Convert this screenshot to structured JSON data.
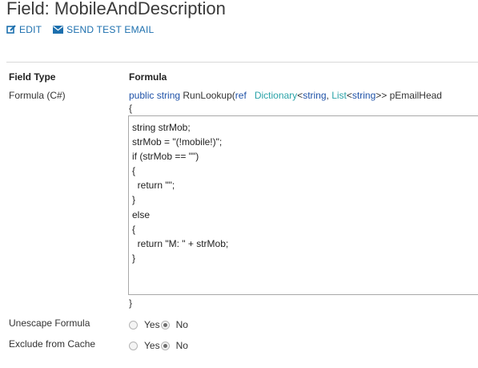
{
  "header": {
    "title": "Field: MobileAndDescription",
    "edit_label": "EDIT",
    "send_test_email_label": "SEND TEST EMAIL"
  },
  "table": {
    "col_field_type": "Field Type",
    "col_formula": "Formula"
  },
  "formula_row": {
    "label": "Formula (C#)",
    "signature": {
      "public_kw": "public",
      "string_kw": "string",
      "method": "RunLookup(",
      "ref_kw": "ref",
      "dictionary_type": "Dictionary",
      "lt1": "<",
      "string_kw2": "string",
      "comma": ", ",
      "list_type": "List",
      "lt2": "<",
      "string_kw3": "string",
      "gt": ">> pEmailHead"
    },
    "open_brace": "{",
    "close_brace": "}",
    "code": "string strMob;\nstrMob = \"(!mobile!)\";\nif (strMob == \"\")\n{\n  return \"\";\n}\nelse\n{\n  return \"M: \" + strMob;\n}"
  },
  "unescape_formula": {
    "label": "Unescape Formula",
    "yes_label": "Yes",
    "no_label": "No",
    "selected": "No"
  },
  "exclude_from_cache": {
    "label": "Exclude from Cache",
    "yes_label": "Yes",
    "no_label": "No",
    "selected": "No"
  },
  "colors": {
    "link": "#1c6fae",
    "keyword": "#1f52a8",
    "type": "#2aa3a8"
  }
}
